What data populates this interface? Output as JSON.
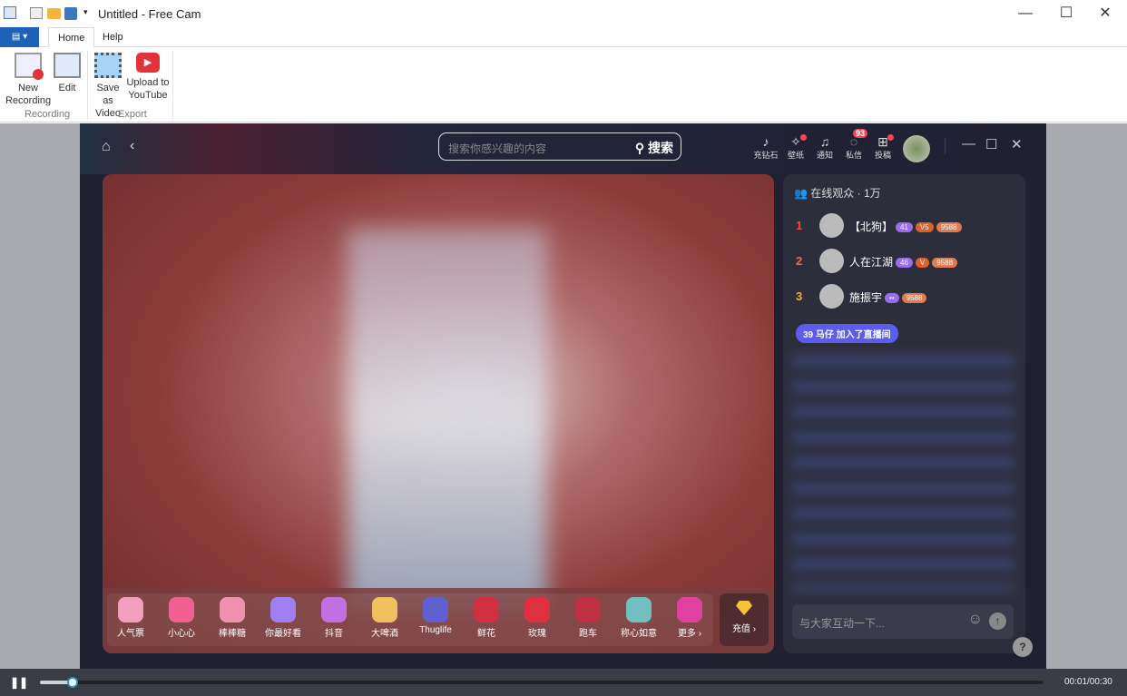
{
  "window": {
    "title": "Untitled - Free Cam",
    "min": "—",
    "max": "☐",
    "close": "✕"
  },
  "tabs": [
    {
      "label": "Home"
    },
    {
      "label": "Help"
    }
  ],
  "file_menu": "▤ ▾",
  "ribbon": {
    "new_recording": "New Recording",
    "edit": "Edit",
    "save_video": "Save as Video",
    "upload": "Upload to YouTube",
    "group_recording": "Recording",
    "group_export": "Export"
  },
  "app": {
    "search_placeholder": "搜索你感兴趣的内容",
    "search_button": "搜索",
    "top_icons": [
      {
        "label": "充钻石",
        "icon": "diamond-icon"
      },
      {
        "label": "壁纸",
        "icon": "wallpaper-icon"
      },
      {
        "label": "通知",
        "icon": "bell-icon"
      },
      {
        "label": "私信",
        "icon": "message-icon",
        "badge": "93"
      },
      {
        "label": "投稿",
        "icon": "upload-icon"
      }
    ],
    "viewers": "在线观众 · 1万",
    "ranks": [
      {
        "n": "1",
        "name": "【北狗】",
        "badges": [
          "41",
          "V5",
          "9588"
        ]
      },
      {
        "n": "2",
        "name": "人在江湖",
        "badges": [
          "46",
          "V",
          "9588"
        ]
      },
      {
        "n": "3",
        "name": "施振宇",
        "badges": [
          "••",
          "9588"
        ]
      }
    ],
    "join_msg": "39 马仔 加入了直播间",
    "chat_placeholder": "与大家互动一下...",
    "gifts": [
      "人气票",
      "小心心",
      "棒棒糖",
      "你最好看",
      "抖音",
      "大啤酒",
      "Thuglife",
      "鲜花",
      "玫瑰",
      "跑车",
      "称心如意",
      "更多 ›"
    ],
    "recharge": "充值 ›"
  },
  "player": {
    "time": "00:01/00:30",
    "progress": 0.033
  },
  "colors": {
    "accent": "#1c63b7",
    "join": "#5b5df0",
    "badge": "#f2475d"
  }
}
